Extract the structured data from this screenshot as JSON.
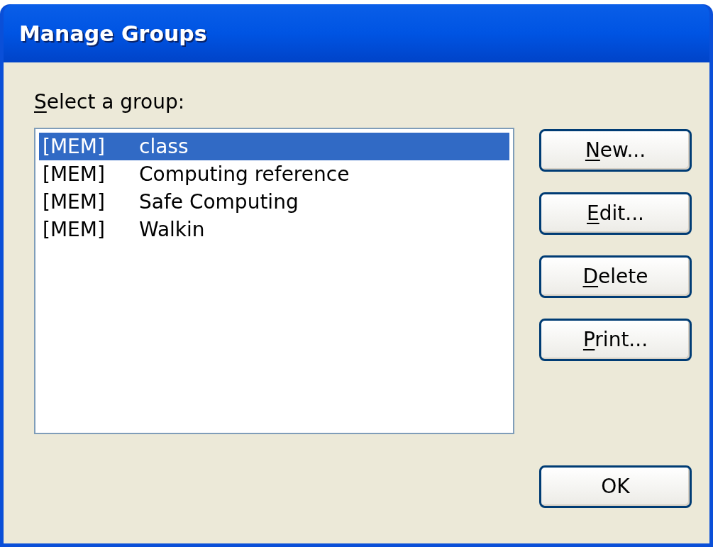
{
  "window": {
    "title": "Manage Groups"
  },
  "prompt": {
    "label": "Select a group:",
    "first_letter_underlined": true
  },
  "groups": [
    {
      "type": "[MEM]",
      "name": "class",
      "selected": true
    },
    {
      "type": "[MEM]",
      "name": "Computing reference",
      "selected": false
    },
    {
      "type": "[MEM]",
      "name": "Safe Computing",
      "selected": false
    },
    {
      "type": "[MEM]",
      "name": "Walkin",
      "selected": false
    }
  ],
  "buttons": [
    {
      "label": "New...",
      "first_letter_underlined": true
    },
    {
      "label": "Edit...",
      "first_letter_underlined": true
    },
    {
      "label": "Delete",
      "first_letter_underlined": true
    },
    {
      "label": "Print...",
      "first_letter_underlined": true
    }
  ],
  "ok_button": {
    "label": "OK"
  }
}
